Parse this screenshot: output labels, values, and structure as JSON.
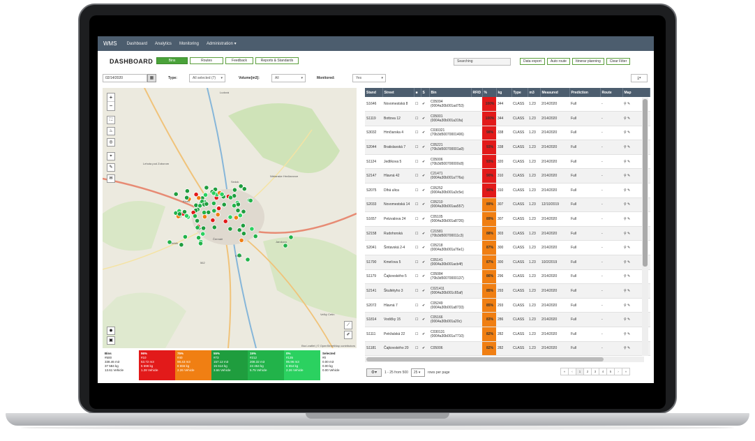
{
  "navbar": {
    "brand": "WMS",
    "items": [
      "Dashboard",
      "Analytics",
      "Monitoring",
      "Administration ▾"
    ]
  },
  "header": {
    "title": "DASHBOARD",
    "tabs": [
      "Bins",
      "Routes",
      "Feedback",
      "Reports & Standards"
    ],
    "search_placeholder": "Searching",
    "right_buttons": [
      "Data export",
      "Auto route",
      "Itinerar planning",
      "Clear Filter"
    ]
  },
  "filters": {
    "date": "02/14/2020",
    "type_label": "Type:",
    "type_value": "All selected (7)",
    "volume_label": "Volume[m3]:",
    "volume_value": "All",
    "monitored_label": "Monitored:",
    "monitored_value": "Yes"
  },
  "map": {
    "attribution": "Bra Leaflet | © OpenStreetMap contributors",
    "places": [
      "Ludová",
      "Sedok",
      "Kines",
      "Čermáň",
      "Jelšik",
      "Jarokovo",
      "Kríva",
      "562",
      "Veľký Cetín",
      "Lehota pod Zoborom",
      "Nitrianske Hrnčiarovce"
    ]
  },
  "stats": [
    {
      "header": "Bins",
      "lines": [
        "#500",
        "338.46 m3",
        "37 584 kg",
        "13.61 Vehicle"
      ]
    },
    {
      "header": "96%",
      "lines": [
        "#10",
        "53.72 m3",
        "5 698 kg",
        "1.28 Vehicle"
      ]
    },
    {
      "header": "75%",
      "lines": [
        "#40",
        "98.43 m3",
        "8 656 kg",
        "2.26 Vehicle"
      ]
    },
    {
      "header": "55%",
      "lines": [
        "#73",
        "157.12 m3",
        "15 614 kg",
        "3.66 Vehicle"
      ]
    },
    {
      "header": "15%",
      "lines": [
        "#212",
        "208.32 m3",
        "24 454 kg",
        "5.75 Vehicle"
      ]
    },
    {
      "header": "0%",
      "lines": [
        "#135",
        "95.96 m3",
        "6 654 kg",
        "2.26 Vehicle"
      ]
    },
    {
      "header": "Selected",
      "lines": [
        "#0",
        "0.00 m3",
        "0.00 kg",
        "0.00 Vehicle"
      ]
    }
  ],
  "table": {
    "columns": [
      "Stand",
      "Street",
      "■",
      "S",
      "Bin",
      "RFID",
      "%",
      "kg",
      "Type",
      "m3",
      "Measured",
      "Prediction",
      "Route",
      "Map"
    ],
    "rows": [
      {
        "stand": "S1646",
        "street": "Novomestská 8",
        "bin": "C05094",
        "rfid_code": "(0004a30b001ad753)",
        "pct": "100%",
        "kg": "344",
        "type": "CLASS",
        "m3": "1.23",
        "measured": "2/14/2020",
        "prediction": "Full",
        "route": "-",
        "color": "#e21a1a"
      },
      {
        "stand": "S1119",
        "street": "Bottova 12",
        "bin": "C05001",
        "rfid_code": "(0004a30b001a31fa)",
        "pct": "100%",
        "kg": "344",
        "type": "CLASS",
        "m3": "1.23",
        "measured": "2/14/2020",
        "prediction": "Full",
        "route": "-",
        "color": "#e21a1a"
      },
      {
        "stand": "S3032",
        "street": "Hrnčiarska 4",
        "bin": "C030321",
        "rfid_code": "(70b3d50070001406)",
        "pct": "98%",
        "kg": "338",
        "type": "CLASS",
        "m3": "1.23",
        "measured": "2/14/2020",
        "prediction": "Full",
        "route": "-",
        "color": "#e21a1a"
      },
      {
        "stand": "S2044",
        "street": "Bratislavská 7",
        "bin": "C05221",
        "rfid_code": "(70b3d500700001a9)",
        "pct": "93%",
        "kg": "338",
        "type": "CLASS",
        "m3": "1.23",
        "measured": "2/14/2020",
        "prediction": "Full",
        "route": "-",
        "color": "#e21a1a"
      },
      {
        "stand": "S1124",
        "street": "Jedlíkova 5",
        "bin": "C05006",
        "rfid_code": "(70b3d500700000c8)",
        "pct": "93%",
        "kg": "320",
        "type": "CLASS",
        "m3": "1.23",
        "measured": "2/14/2020",
        "prediction": "Full",
        "route": "-",
        "color": "#e21a1a"
      },
      {
        "stand": "S2147",
        "street": "Hlavná 42",
        "bin": "C21471",
        "rfid_code": "(0004a30b001a776a)",
        "pct": "90%",
        "kg": "310",
        "type": "CLASS",
        "m3": "1.23",
        "measured": "2/14/2020",
        "prediction": "Full",
        "route": "-",
        "color": "#e21a1a"
      },
      {
        "stand": "S2075",
        "street": "Dlhá ulica",
        "bin": "C05252",
        "rfid_code": "(0004a30b001a3c5e)",
        "pct": "90%",
        "kg": "310",
        "type": "CLASS",
        "m3": "1.23",
        "measured": "2/14/2020",
        "prediction": "Full",
        "route": "-",
        "color": "#e21a1a"
      },
      {
        "stand": "S2033",
        "street": "Novomestská 14",
        "bin": "C05210",
        "rfid_code": "(0004a30b001aa557)",
        "pct": "89%",
        "kg": "307",
        "type": "CLASS",
        "m3": "1.23",
        "measured": "12/10/2019",
        "prediction": "Full",
        "route": "-",
        "color": "#f07f13"
      },
      {
        "stand": "S1657",
        "street": "Petzvalova 24",
        "bin": "C05105",
        "rfid_code": "(0004a30b001a8726)",
        "pct": "89%",
        "kg": "307",
        "type": "CLASS",
        "m3": "1.23",
        "measured": "2/14/2020",
        "prediction": "Full",
        "route": "-",
        "color": "#f07f13"
      },
      {
        "stand": "S2158",
        "street": "Rudohorská",
        "bin": "C21581",
        "rfid_code": "(70b3d500700011c3)",
        "pct": "88%",
        "kg": "303",
        "type": "CLASS",
        "m3": "1.23",
        "measured": "2/14/2020",
        "prediction": "Full",
        "route": "-",
        "color": "#f07f13"
      },
      {
        "stand": "S2041",
        "street": "Šintavská 2-4",
        "bin": "C05218",
        "rfid_code": "(0004a30b001a76e1)",
        "pct": "87%",
        "kg": "300",
        "type": "CLASS",
        "m3": "1.23",
        "measured": "2/14/2020",
        "prediction": "Full",
        "route": "-",
        "color": "#f07f13"
      },
      {
        "stand": "S1790",
        "street": "Kmeťova 5",
        "bin": "C05141",
        "rfid_code": "(0004a30b001acb4f)",
        "pct": "87%",
        "kg": "300",
        "type": "CLASS",
        "m3": "1.23",
        "measured": "10/2/2019",
        "prediction": "Full",
        "route": "-",
        "color": "#f07f13"
      },
      {
        "stand": "S1179",
        "street": "Čajkovského 5",
        "bin": "C05084",
        "rfid_code": "(70b3d50070000137)",
        "pct": "86%",
        "kg": "296",
        "type": "CLASS",
        "m3": "1.23",
        "measured": "2/14/2020",
        "prediction": "Full",
        "route": "-",
        "color": "#f07f13"
      },
      {
        "stand": "S2141",
        "street": "Škultétyho 3",
        "bin": "C021411",
        "rfid_code": "(0004a30b001c65af)",
        "pct": "85%",
        "kg": "293",
        "type": "CLASS",
        "m3": "1.23",
        "measured": "2/14/2020",
        "prediction": "Full",
        "route": "-",
        "color": "#f07f13"
      },
      {
        "stand": "S2072",
        "street": "Hlavná 7",
        "bin": "C05249",
        "rfid_code": "(0004a30b001a8733)",
        "pct": "85%",
        "kg": "293",
        "type": "CLASS",
        "m3": "1.23",
        "measured": "2/14/2020",
        "prediction": "Full",
        "route": "-",
        "color": "#f07f13"
      },
      {
        "stand": "S1814",
        "street": "Vodičky 15",
        "bin": "C05166",
        "rfid_code": "(0004a30b001a20c)",
        "pct": "83%",
        "kg": "286",
        "type": "CLASS",
        "m3": "1.23",
        "measured": "2/14/2020",
        "prediction": "Full",
        "route": "-",
        "color": "#f07f13"
      },
      {
        "stand": "S1111",
        "street": "Petržalská 22",
        "bin": "C030131",
        "rfid_code": "(0004a30b001a7710)",
        "pct": "82%",
        "kg": "282",
        "type": "CLASS",
        "m3": "1.23",
        "measured": "2/14/2020",
        "prediction": "Full",
        "route": "-",
        "color": "#f07f13"
      },
      {
        "stand": "S1181",
        "street": "Čajkovského 20",
        "bin": "C05006",
        "rfid_code": "",
        "pct": "82%",
        "kg": "282",
        "type": "CLASS",
        "m3": "1.23",
        "measured": "2/14/2020",
        "prediction": "Full",
        "route": "-",
        "color": "#f07f13"
      }
    ]
  },
  "pager": {
    "range_text": "1 - 25 from 500",
    "per_page_value": "25",
    "per_page_label": "rows per page",
    "buttons": [
      "«",
      "‹",
      "1",
      "2",
      "3",
      "4",
      "5",
      "›",
      "»"
    ]
  }
}
